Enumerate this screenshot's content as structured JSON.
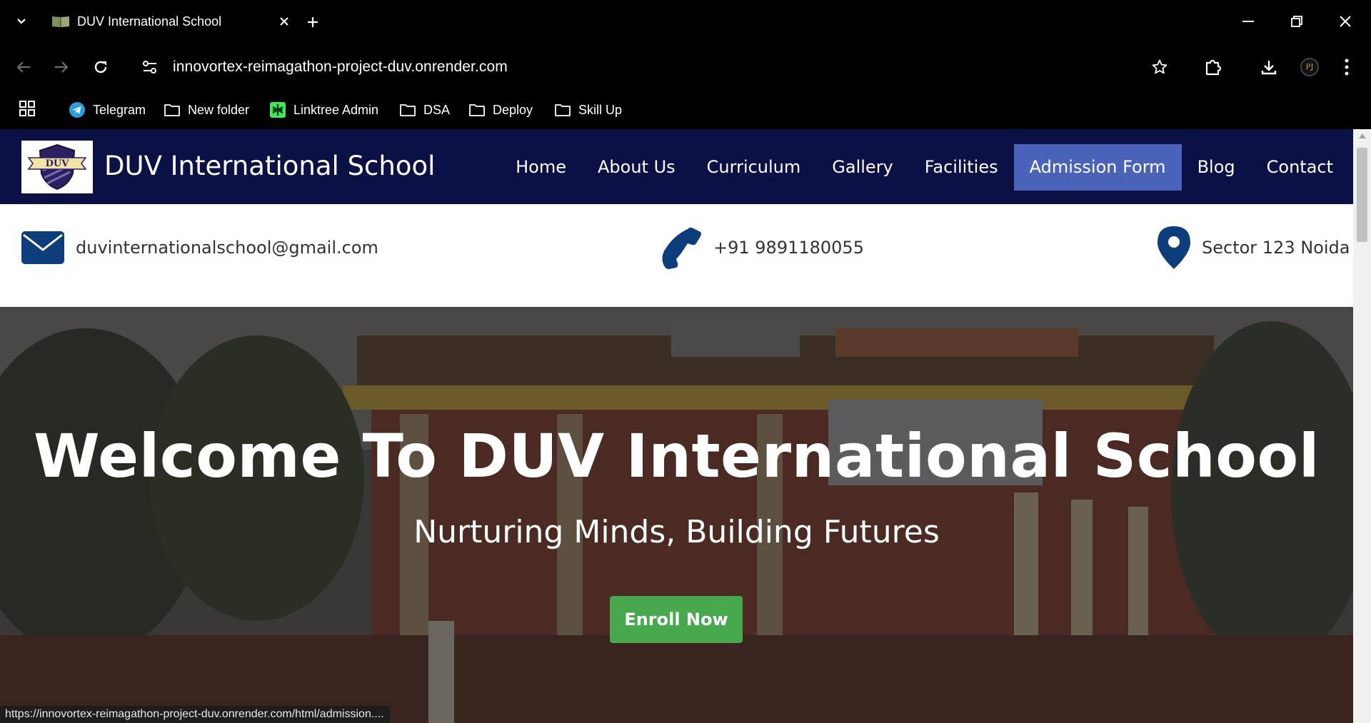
{
  "browser": {
    "tab": {
      "title": "DUV International School"
    },
    "url": "innovortex-reimagathon-project-duv.onrender.com",
    "profile_initials": "PJ",
    "bookmarks": [
      {
        "label": "Telegram",
        "icon": "telegram-icon"
      },
      {
        "label": "New folder",
        "icon": "folder-icon"
      },
      {
        "label": "Linktree Admin",
        "icon": "linktree-icon"
      },
      {
        "label": "DSA",
        "icon": "folder-icon"
      },
      {
        "label": "Deploy",
        "icon": "folder-icon"
      },
      {
        "label": "Skill Up",
        "icon": "folder-icon"
      }
    ],
    "status_url": "https://innovortex-reimagathon-project-duv.onrender.com/html/admission...."
  },
  "site": {
    "logo_text": "DUV",
    "title": "DUV International School",
    "nav": [
      {
        "label": "Home"
      },
      {
        "label": "About Us"
      },
      {
        "label": "Curriculum"
      },
      {
        "label": "Gallery"
      },
      {
        "label": "Facilities"
      },
      {
        "label": "Admission Form",
        "active": true
      },
      {
        "label": "Blog"
      },
      {
        "label": "Contact"
      }
    ],
    "contact": {
      "email": "duvinternationalschool@gmail.com",
      "phone": "+91 9891180055",
      "address": "Sector 123 Noida"
    },
    "hero": {
      "title": "Welcome To DUV International School",
      "subtitle": "Nurturing Minds, Building Futures",
      "cta": "Enroll Now"
    }
  },
  "colors": {
    "nav_bg": "#0c1145",
    "nav_active": "#4a63b8",
    "icon_blue": "#0d3d7a",
    "cta_green": "#47a84e"
  }
}
